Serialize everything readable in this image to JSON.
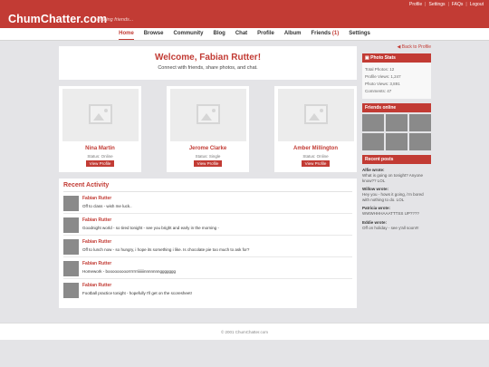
{
  "site": {
    "brand": "ChumChatter.com",
    "tagline": "making friends..."
  },
  "toplinks": [
    "Profile",
    "Settings",
    "FAQs",
    "Logout"
  ],
  "nav": {
    "items": [
      {
        "label": "Home"
      },
      {
        "label": "Browse"
      },
      {
        "label": "Community"
      },
      {
        "label": "Blog"
      },
      {
        "label": "Chat"
      },
      {
        "label": "Profile"
      },
      {
        "label": "Album"
      },
      {
        "label": "Friends "
      },
      {
        "label": "Settings"
      }
    ],
    "friends_count": "(1)"
  },
  "welcome": {
    "title": "Welcome, Fabian Rutter!",
    "subtitle": "Connect with friends, share photos, and chat."
  },
  "friends": [
    {
      "name": "Nina Martin",
      "status": "Status: Online",
      "button": "View Profile"
    },
    {
      "name": "Jerome Clarke",
      "status": "Status: Single",
      "button": "View Profile"
    },
    {
      "name": "Amber Millington",
      "status": "Status: Online",
      "button": "View Profile"
    }
  ],
  "activity": {
    "title": "Recent Activity",
    "items": [
      {
        "name": "Fabian Rutter",
        "text": "Off to class - wish me luck.."
      },
      {
        "name": "Fabian Rutter",
        "text": "Goodnight world - so tired tonight - see you bright and early in the morning -"
      },
      {
        "name": "Fabian Rutter",
        "text": "Off to lunch now - so hungry, i hope its something i like. Is chocolate pie too much to ask for?"
      },
      {
        "name": "Fabian Rutter",
        "text": "Homework - booooooooorrrrrrriiiiiiinnnnnnnggggggg"
      },
      {
        "name": "Fabian Rutter",
        "text": "Football practice tonight - hopefully I'll get on the scoresheet!"
      }
    ]
  },
  "sidebar": {
    "back_link": "◀ Back to Profile",
    "stats_title": "Photo Stats",
    "stats": [
      "Total Photos: 12",
      "Profile Views: 1,247",
      "Photo Views: 3,891",
      "Comments: 47"
    ],
    "friends_online_title": "Friends online",
    "recent_posts_title": "Recent posts",
    "posts": [
      {
        "who": "Alfie wrote:",
        "what": "What is going on tonight? Anyone know?? LOL"
      },
      {
        "who": "Willow wrote:",
        "what": "Hey you - hows it going, i'm bored with nothing to do. LOL"
      },
      {
        "who": "Patricia wrote:",
        "what": "WWWHHHAAATTTSS UP????"
      },
      {
        "who": "Eddie wrote:",
        "what": "Off on holiday - see y'all soon!!!"
      }
    ]
  },
  "footer": "© 2001 ChumChatter.com",
  "colors": {
    "accent": "#c23b34",
    "background": "#e4e4e7",
    "placeholder": "#8a8a8a"
  }
}
